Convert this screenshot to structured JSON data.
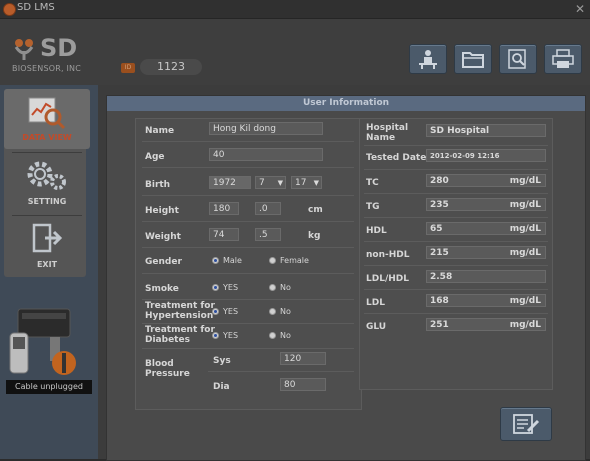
{
  "window": {
    "title": "SD LMS"
  },
  "logo": {
    "brand": "SD",
    "company": "BIOSENSOR, INC"
  },
  "id": {
    "badge": "ID",
    "value": "1123"
  },
  "toolbar": [
    {
      "name": "patient-tool-button",
      "icon": "person-at-desk-icon"
    },
    {
      "name": "open-folder-button",
      "icon": "folder-icon"
    },
    {
      "name": "search-document-button",
      "icon": "magnifier-document-icon"
    },
    {
      "name": "print-button",
      "icon": "printer-icon"
    }
  ],
  "sidebar": {
    "items": [
      {
        "label": "DATA VIEW",
        "icon": "chart-magnifier-icon",
        "active": true
      },
      {
        "label": "SETTING",
        "icon": "gears-icon",
        "active": false
      },
      {
        "label": "EXIT",
        "icon": "exit-door-icon",
        "active": false
      }
    ],
    "device_status": "Cable unplugged"
  },
  "user_info": {
    "title": "User Information",
    "name": {
      "label": "Name",
      "value": "Hong Kil dong"
    },
    "age": {
      "label": "Age",
      "value": "40"
    },
    "birth": {
      "label": "Birth",
      "year": "1972",
      "month": "7",
      "day": "17"
    },
    "height": {
      "label": "Height",
      "int": "180",
      "dec": ".0",
      "unit": "cm"
    },
    "weight": {
      "label": "Weight",
      "int": "74",
      "dec": ".5",
      "unit": "kg"
    },
    "gender": {
      "label": "Gender",
      "options": [
        "Male",
        "Female"
      ],
      "selected": "Male"
    },
    "smoke": {
      "label": "Smoke",
      "options": [
        "YES",
        "No"
      ],
      "selected": "YES"
    },
    "hypertension": {
      "label_line1": "Treatment for",
      "label_line2": "Hypertension",
      "options": [
        "YES",
        "No"
      ],
      "selected": "YES"
    },
    "diabetes": {
      "label_line1": "Treatment for",
      "label_line2": "Diabetes",
      "options": [
        "YES",
        "No"
      ],
      "selected": "YES"
    },
    "blood_pressure": {
      "label_line1": "Blood",
      "label_line2": "Pressure",
      "sys_label": "Sys",
      "sys_value": "120",
      "dia_label": "Dia",
      "dia_value": "80"
    }
  },
  "results": {
    "hospital": {
      "label_line1": "Hospital",
      "label_line2": "Name",
      "value": "SD Hospital"
    },
    "tested_date": {
      "label": "Tested Date",
      "value": "2012-02-09 12:16"
    },
    "items": [
      {
        "label": "TC",
        "value": "280",
        "unit": "mg/dL"
      },
      {
        "label": "TG",
        "value": "235",
        "unit": "mg/dL"
      },
      {
        "label": "HDL",
        "value": "65",
        "unit": "mg/dL"
      },
      {
        "label": "non-HDL",
        "value": "215",
        "unit": "mg/dL"
      },
      {
        "label": "LDL/HDL",
        "value": "2.58",
        "unit": ""
      },
      {
        "label": "LDL",
        "value": "168",
        "unit": "mg/dL"
      },
      {
        "label": "GLU",
        "value": "251",
        "unit": "mg/dL"
      }
    ]
  },
  "actions": {
    "save_icon": "document-edit-icon"
  },
  "colors": {
    "accent_orange": "#c24b2a",
    "header_blue": "#5a6a80",
    "radio_selected": "#2d4fa0"
  }
}
